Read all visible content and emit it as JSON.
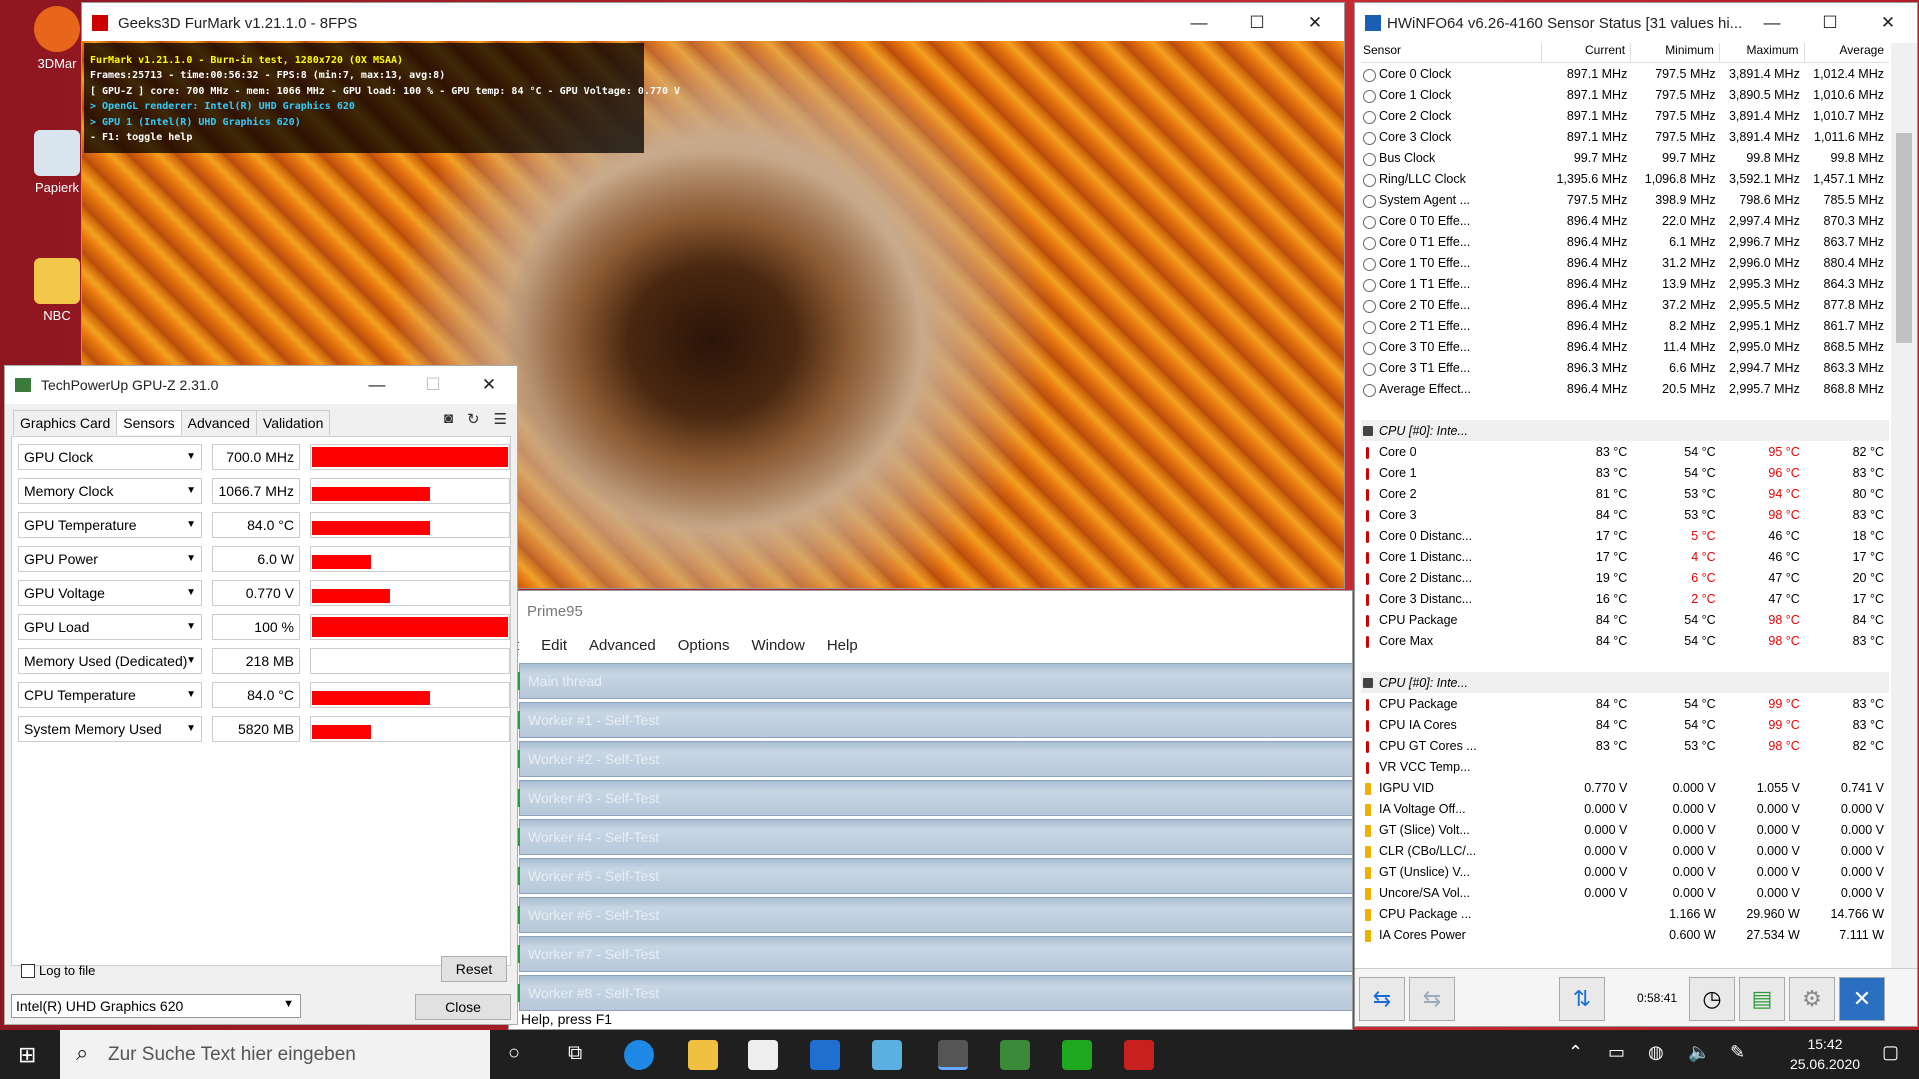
{
  "desktop": {
    "icons": [
      "3DMar",
      "Papierk",
      "NBC"
    ]
  },
  "furmark": {
    "title": "Geeks3D FurMark v1.21.1.0 - 8FPS",
    "overlay": [
      "FurMark v1.21.1.0 - Burn-in test, 1280x720 (0X MSAA)",
      "Frames:25713 - time:00:56:32 - FPS:8 (min:7, max:13, avg:8)",
      "[ GPU-Z ] core: 700 MHz - mem: 1066 MHz - GPU load: 100 % - GPU temp: 84 °C - GPU Voltage: 0.770 V",
      "> OpenGL renderer: Intel(R) UHD Graphics 620",
      "> GPU 1 (Intel(R) UHD Graphics 620)",
      "- F1: toggle help"
    ]
  },
  "gpuz": {
    "title": "TechPowerUp GPU-Z 2.31.0",
    "tabs": [
      "Graphics Card",
      "Sensors",
      "Advanced",
      "Validation"
    ],
    "sensors": [
      {
        "label": "GPU Clock",
        "value": "700.0 MHz",
        "level": 1.0
      },
      {
        "label": "Memory Clock",
        "value": "1066.7 MHz",
        "level": 0.6
      },
      {
        "label": "GPU Temperature",
        "value": "84.0 °C",
        "level": 0.6
      },
      {
        "label": "GPU Power",
        "value": "6.0 W",
        "level": 0.3
      },
      {
        "label": "GPU Voltage",
        "value": "0.770 V",
        "level": 0.4
      },
      {
        "label": "GPU Load",
        "value": "100 %",
        "level": 1.0
      },
      {
        "label": "Memory Used (Dedicated)",
        "value": "218 MB",
        "level": 0
      },
      {
        "label": "CPU Temperature",
        "value": "84.0 °C",
        "level": 0.6
      },
      {
        "label": "System Memory Used",
        "value": "5820 MB",
        "level": 0.3
      }
    ],
    "log_label": "Log to file",
    "reset": "Reset",
    "device": "Intel(R) UHD Graphics 620",
    "close": "Close"
  },
  "prime95": {
    "title": "Prime95",
    "menu": [
      "t",
      "Edit",
      "Advanced",
      "Options",
      "Window",
      "Help"
    ],
    "workers": [
      "Main thread",
      "Worker #1 - Self-Test",
      "Worker #2 - Self-Test",
      "Worker #3 - Self-Test",
      "Worker #4 - Self-Test",
      "Worker #5 - Self-Test",
      "Worker #6 - Self-Test",
      "Worker #7 - Self-Test",
      "Worker #8 - Self-Test"
    ],
    "status": "Help, press F1"
  },
  "hwinfo": {
    "title": "HWiNFO64 v6.26-4160 Sensor Status [31 values hi...",
    "headers": [
      "Sensor",
      "Current",
      "Minimum",
      "Maximum",
      "Average"
    ],
    "rows": [
      {
        "k": "c",
        "n": "Core 0 Clock",
        "c": "897.1 MHz",
        "mi": "797.5 MHz",
        "ma": "3,891.4 MHz",
        "av": "1,012.4 MHz"
      },
      {
        "k": "c",
        "n": "Core 1 Clock",
        "c": "897.1 MHz",
        "mi": "797.5 MHz",
        "ma": "3,890.5 MHz",
        "av": "1,010.6 MHz"
      },
      {
        "k": "c",
        "n": "Core 2 Clock",
        "c": "897.1 MHz",
        "mi": "797.5 MHz",
        "ma": "3,891.4 MHz",
        "av": "1,010.7 MHz"
      },
      {
        "k": "c",
        "n": "Core 3 Clock",
        "c": "897.1 MHz",
        "mi": "797.5 MHz",
        "ma": "3,891.4 MHz",
        "av": "1,011.6 MHz"
      },
      {
        "k": "c",
        "n": "Bus Clock",
        "c": "99.7 MHz",
        "mi": "99.7 MHz",
        "ma": "99.8 MHz",
        "av": "99.8 MHz"
      },
      {
        "k": "c",
        "n": "Ring/LLC Clock",
        "c": "1,395.6 MHz",
        "mi": "1,096.8 MHz",
        "ma": "3,592.1 MHz",
        "av": "1,457.1 MHz"
      },
      {
        "k": "c",
        "n": "System Agent ...",
        "c": "797.5 MHz",
        "mi": "398.9 MHz",
        "ma": "798.6 MHz",
        "av": "785.5 MHz"
      },
      {
        "k": "c",
        "n": "Core 0 T0 Effe...",
        "c": "896.4 MHz",
        "mi": "22.0 MHz",
        "ma": "2,997.4 MHz",
        "av": "870.3 MHz"
      },
      {
        "k": "c",
        "n": "Core 0 T1 Effe...",
        "c": "896.4 MHz",
        "mi": "6.1 MHz",
        "ma": "2,996.7 MHz",
        "av": "863.7 MHz"
      },
      {
        "k": "c",
        "n": "Core 1 T0 Effe...",
        "c": "896.4 MHz",
        "mi": "31.2 MHz",
        "ma": "2,996.0 MHz",
        "av": "880.4 MHz"
      },
      {
        "k": "c",
        "n": "Core 1 T1 Effe...",
        "c": "896.4 MHz",
        "mi": "13.9 MHz",
        "ma": "2,995.3 MHz",
        "av": "864.3 MHz"
      },
      {
        "k": "c",
        "n": "Core 2 T0 Effe...",
        "c": "896.4 MHz",
        "mi": "37.2 MHz",
        "ma": "2,995.5 MHz",
        "av": "877.8 MHz"
      },
      {
        "k": "c",
        "n": "Core 2 T1 Effe...",
        "c": "896.4 MHz",
        "mi": "8.2 MHz",
        "ma": "2,995.1 MHz",
        "av": "861.7 MHz"
      },
      {
        "k": "c",
        "n": "Core 3 T0 Effe...",
        "c": "896.4 MHz",
        "mi": "11.4 MHz",
        "ma": "2,995.0 MHz",
        "av": "868.5 MHz"
      },
      {
        "k": "c",
        "n": "Core 3 T1 Effe...",
        "c": "896.3 MHz",
        "mi": "6.6 MHz",
        "ma": "2,994.7 MHz",
        "av": "863.3 MHz"
      },
      {
        "k": "c",
        "n": "Average Effect...",
        "c": "896.4 MHz",
        "mi": "20.5 MHz",
        "ma": "2,995.7 MHz",
        "av": "868.8 MHz"
      },
      {
        "k": "blank",
        "n": "",
        "c": "",
        "mi": "",
        "ma": "",
        "av": ""
      },
      {
        "k": "grp",
        "n": "CPU [#0]: Inte...",
        "c": "",
        "mi": "",
        "ma": "",
        "av": ""
      },
      {
        "k": "t",
        "n": "Core 0",
        "c": "83 °C",
        "mi": "54 °C",
        "ma": "95 °C",
        "av": "82 °C",
        "r": "ma"
      },
      {
        "k": "t",
        "n": "Core 1",
        "c": "83 °C",
        "mi": "54 °C",
        "ma": "96 °C",
        "av": "83 °C",
        "r": "ma"
      },
      {
        "k": "t",
        "n": "Core 2",
        "c": "81 °C",
        "mi": "53 °C",
        "ma": "94 °C",
        "av": "80 °C",
        "r": "ma"
      },
      {
        "k": "t",
        "n": "Core 3",
        "c": "84 °C",
        "mi": "53 °C",
        "ma": "98 °C",
        "av": "83 °C",
        "r": "ma"
      },
      {
        "k": "t",
        "n": "Core 0 Distanc...",
        "c": "17 °C",
        "mi": "5 °C",
        "ma": "46 °C",
        "av": "18 °C",
        "r": "mi"
      },
      {
        "k": "t",
        "n": "Core 1 Distanc...",
        "c": "17 °C",
        "mi": "4 °C",
        "ma": "46 °C",
        "av": "17 °C",
        "r": "mi"
      },
      {
        "k": "t",
        "n": "Core 2 Distanc...",
        "c": "19 °C",
        "mi": "6 °C",
        "ma": "47 °C",
        "av": "20 °C",
        "r": "mi"
      },
      {
        "k": "t",
        "n": "Core 3 Distanc...",
        "c": "16 °C",
        "mi": "2 °C",
        "ma": "47 °C",
        "av": "17 °C",
        "r": "mi"
      },
      {
        "k": "t",
        "n": "CPU Package",
        "c": "84 °C",
        "mi": "54 °C",
        "ma": "98 °C",
        "av": "84 °C",
        "r": "ma"
      },
      {
        "k": "t",
        "n": "Core Max",
        "c": "84 °C",
        "mi": "54 °C",
        "ma": "98 °C",
        "av": "83 °C",
        "r": "ma"
      },
      {
        "k": "blank",
        "n": "",
        "c": "",
        "mi": "",
        "ma": "",
        "av": ""
      },
      {
        "k": "grp",
        "n": "CPU [#0]: Inte...",
        "c": "",
        "mi": "",
        "ma": "",
        "av": ""
      },
      {
        "k": "t",
        "n": "CPU Package",
        "c": "84 °C",
        "mi": "54 °C",
        "ma": "99 °C",
        "av": "83 °C",
        "r": "ma"
      },
      {
        "k": "t",
        "n": "CPU IA Cores",
        "c": "84 °C",
        "mi": "54 °C",
        "ma": "99 °C",
        "av": "83 °C",
        "r": "ma"
      },
      {
        "k": "t",
        "n": "CPU GT Cores ...",
        "c": "83 °C",
        "mi": "53 °C",
        "ma": "98 °C",
        "av": "82 °C",
        "r": "ma"
      },
      {
        "k": "t",
        "n": "VR VCC Temp...",
        "c": "",
        "mi": "",
        "ma": "",
        "av": ""
      },
      {
        "k": "v",
        "n": "IGPU VID",
        "c": "0.770 V",
        "mi": "0.000 V",
        "ma": "1.055 V",
        "av": "0.741 V"
      },
      {
        "k": "v",
        "n": "IA Voltage Off...",
        "c": "0.000 V",
        "mi": "0.000 V",
        "ma": "0.000 V",
        "av": "0.000 V"
      },
      {
        "k": "v",
        "n": "GT (Slice) Volt...",
        "c": "0.000 V",
        "mi": "0.000 V",
        "ma": "0.000 V",
        "av": "0.000 V"
      },
      {
        "k": "v",
        "n": "CLR (CBo/LLC/...",
        "c": "0.000 V",
        "mi": "0.000 V",
        "ma": "0.000 V",
        "av": "0.000 V"
      },
      {
        "k": "v",
        "n": "GT (Unslice) V...",
        "c": "0.000 V",
        "mi": "0.000 V",
        "ma": "0.000 V",
        "av": "0.000 V"
      },
      {
        "k": "v",
        "n": "Uncore/SA Vol...",
        "c": "0.000 V",
        "mi": "0.000 V",
        "ma": "0.000 V",
        "av": "0.000 V"
      },
      {
        "k": "v",
        "n": "CPU Package ...",
        "c": "",
        "mi": "1.166 W",
        "ma": "29.960 W",
        "av": "14.766 W"
      },
      {
        "k": "v",
        "n": "IA Cores Power",
        "c": "",
        "mi": "0.600 W",
        "ma": "27.534 W",
        "av": "7.111 W"
      }
    ],
    "timer": "0:58:41"
  },
  "taskbar": {
    "search": "Zur Suche Text hier eingeben",
    "time": "15:42",
    "date": "25.06.2020"
  }
}
